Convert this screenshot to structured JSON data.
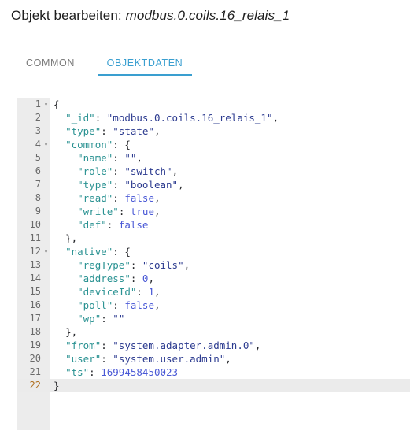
{
  "header": {
    "title_prefix": "Objekt bearbeiten:",
    "object_id": "modbus.0.coils.16_relais_1"
  },
  "tabs": [
    {
      "label": "COMMON",
      "active": false
    },
    {
      "label": "OBJEKTDATEN",
      "active": true
    }
  ],
  "editor": {
    "active_line": 22,
    "cursor_line": 22,
    "fold_lines": [
      1,
      4,
      12
    ],
    "lines": [
      {
        "n": 1,
        "text": "{"
      },
      {
        "n": 2,
        "text": "  \"_id\": \"modbus.0.coils.16_relais_1\","
      },
      {
        "n": 3,
        "text": "  \"type\": \"state\","
      },
      {
        "n": 4,
        "text": "  \"common\": {"
      },
      {
        "n": 5,
        "text": "    \"name\": \"\","
      },
      {
        "n": 6,
        "text": "    \"role\": \"switch\","
      },
      {
        "n": 7,
        "text": "    \"type\": \"boolean\","
      },
      {
        "n": 8,
        "text": "    \"read\": false,"
      },
      {
        "n": 9,
        "text": "    \"write\": true,"
      },
      {
        "n": 10,
        "text": "    \"def\": false"
      },
      {
        "n": 11,
        "text": "  },"
      },
      {
        "n": 12,
        "text": "  \"native\": {"
      },
      {
        "n": 13,
        "text": "    \"regType\": \"coils\","
      },
      {
        "n": 14,
        "text": "    \"address\": 0,"
      },
      {
        "n": 15,
        "text": "    \"deviceId\": 1,"
      },
      {
        "n": 16,
        "text": "    \"poll\": false,"
      },
      {
        "n": 17,
        "text": "    \"wp\": \"\""
      },
      {
        "n": 18,
        "text": "  },"
      },
      {
        "n": 19,
        "text": "  \"from\": \"system.adapter.admin.0\","
      },
      {
        "n": 20,
        "text": "  \"user\": \"system.user.admin\","
      },
      {
        "n": 21,
        "text": "  \"ts\": 1699458450023"
      },
      {
        "n": 22,
        "text": "}"
      }
    ],
    "json_object": {
      "_id": "modbus.0.coils.16_relais_1",
      "type": "state",
      "common": {
        "name": "",
        "role": "switch",
        "type": "boolean",
        "read": false,
        "write": true,
        "def": false
      },
      "native": {
        "regType": "coils",
        "address": 0,
        "deviceId": 1,
        "poll": false,
        "wp": ""
      },
      "from": "system.adapter.admin.0",
      "user": "system.user.admin",
      "ts": 1699458450023
    }
  },
  "colors": {
    "accent": "#3a9fd0",
    "tab_inactive": "#7b7b7b",
    "gutter_bg": "#ececec",
    "active_line_bg": "#ebebeb",
    "active_lineno": "#b07020",
    "token_key": "#2a9292",
    "token_string": "#2b3a8f",
    "token_number": "#4a59d6"
  },
  "icons": {
    "fold": "▾"
  }
}
